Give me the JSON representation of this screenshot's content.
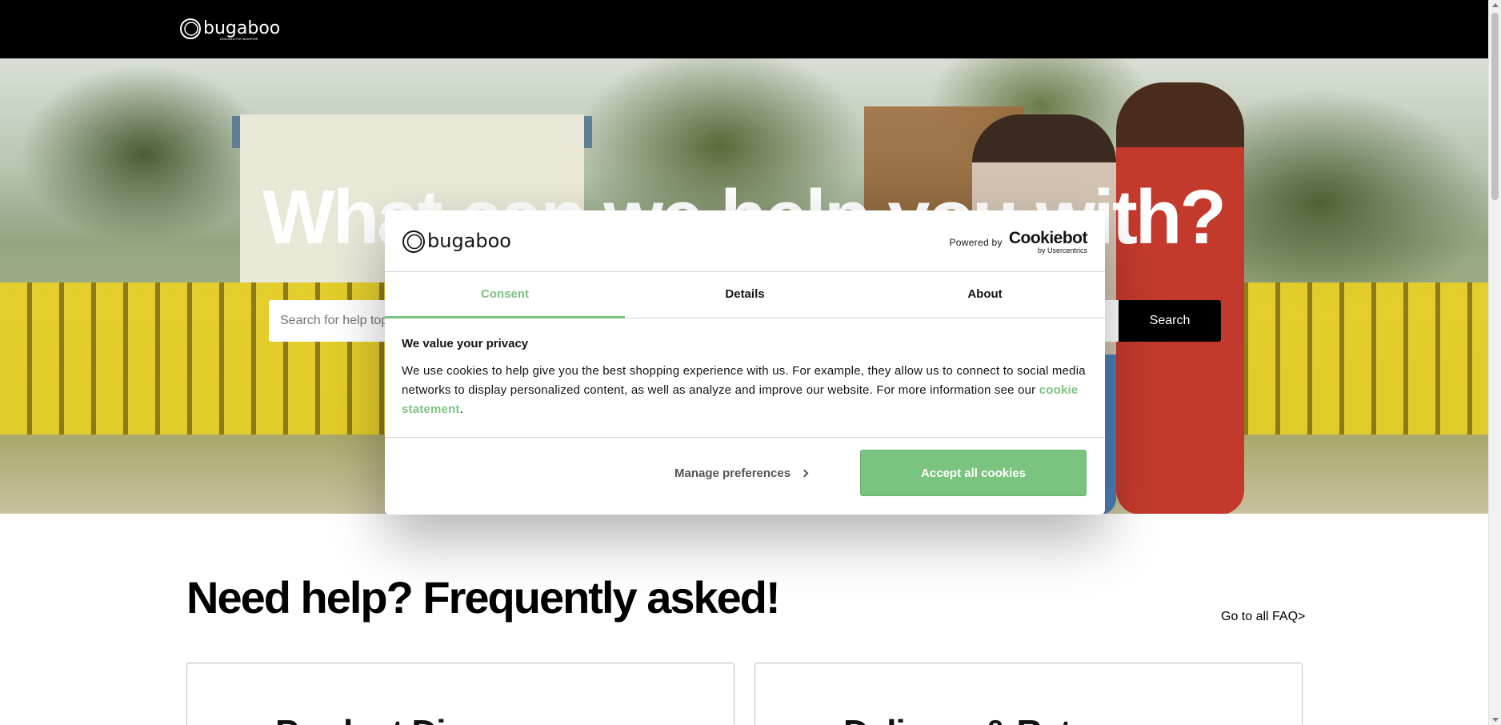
{
  "header": {
    "logo_text": "bugaboo",
    "logo_subtext": "DESIGNED FOR WHATEVER"
  },
  "hero": {
    "title": "What can we help you with?",
    "search_placeholder": "Search for help topics",
    "search_button": "Search"
  },
  "faq": {
    "title": "Need help? Frequently asked!",
    "all_link": "Go to all FAQ>",
    "cards": [
      {
        "title": "Product Discovery"
      },
      {
        "title": "Delivery & Returns"
      }
    ]
  },
  "cookie_dialog": {
    "logo_text": "bugaboo",
    "powered_by_label": "Powered by",
    "powered_by_brand": "Cookiebot",
    "powered_by_sub": "by Usercentrics",
    "tabs": [
      {
        "label": "Consent",
        "active": true
      },
      {
        "label": "Details",
        "active": false
      },
      {
        "label": "About",
        "active": false
      }
    ],
    "heading": "We value your privacy",
    "body_before_link": "We use cookies to help give you the best shopping experience with us. For example, they allow us to connect to social media networks to display personalized content, as well as analyze and improve our website. For more information see our ",
    "link_text": "cookie statement",
    "body_after_link": ".",
    "manage_label": "Manage preferences",
    "accept_label": "Accept all cookies",
    "accent_color": "#7ac47f"
  }
}
